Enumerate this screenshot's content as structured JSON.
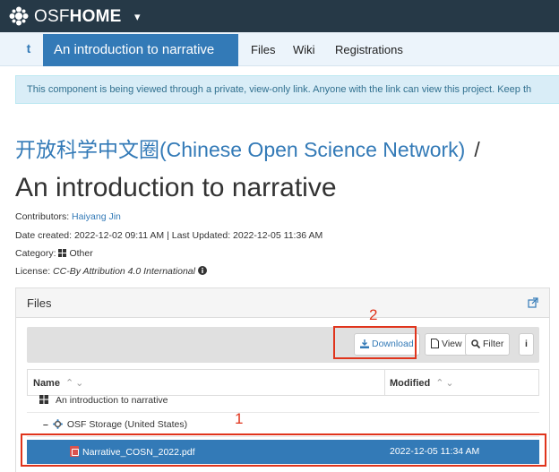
{
  "app": {
    "brand_thin": "OSF",
    "brand_bold": "HOME",
    "brand_caret": "▾"
  },
  "nav": {
    "home_short": "t",
    "active": "An introduction to narrative",
    "links": [
      "Files",
      "Wiki",
      "Registrations"
    ]
  },
  "alert": {
    "text": "This component is being viewed through a private, view-only link. Anyone with the link can view this project. Keep th"
  },
  "project": {
    "parent": "开放科学中文圈(Chinese Open Science Network)",
    "separator": "/",
    "title": "An introduction to narrative",
    "contributors_label": "Contributors:",
    "contributor": "Haiyang Jin",
    "dates": "Date created: 2022-12-02 09:11 AM | Last Updated: 2022-12-05 11:36 AM",
    "category_label": "Category:",
    "category": "Other",
    "license_label": "License:",
    "license": "CC-By Attribution 4.0 International"
  },
  "files_panel": {
    "title": "Files",
    "buttons": {
      "download": "Download",
      "view": "View",
      "filter": "Filter",
      "info": "i"
    },
    "columns": {
      "name": "Name",
      "modified": "Modified",
      "sort": "⌃⌄"
    },
    "rows": [
      {
        "name": "An introduction to narrative",
        "modified": ""
      },
      {
        "name": "OSF Storage (United States)",
        "modified": ""
      },
      {
        "name": "Narrative_COSN_2022.pdf",
        "modified": "2022-12-05 11:34 AM"
      }
    ]
  },
  "annotations": {
    "label_1": "1",
    "label_2": "2",
    "color": "#e0341c"
  },
  "colors": {
    "topbar": "#263947",
    "accent": "#337ab7",
    "alert_bg": "#d9edf7"
  },
  "icons": [
    "osf-logo-icon",
    "grid-icon",
    "info-circle-icon",
    "external-link-icon",
    "download-icon",
    "file-icon",
    "search-icon",
    "gear-storage-icon",
    "pdf-icon"
  ]
}
